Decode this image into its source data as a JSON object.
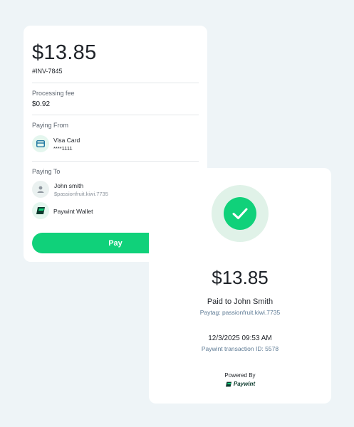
{
  "payment": {
    "amount": "$13.85",
    "invoice": "#INV-7845",
    "fee_label": "Processing fee",
    "fee_value": "$0.92",
    "paying_from_label": "Paying From",
    "card_name": "Visa Card",
    "card_number": "****1111",
    "paying_to_label": "Paying To",
    "payee_name": "John smith",
    "payee_tag": "$passionfruit.kiwi.7735",
    "wallet_name": "Paywint Wallet",
    "pay_button": "Pay"
  },
  "receipt": {
    "amount": "$13.85",
    "paid_to": "Paid to John Smith",
    "paytag": "Paytag: passionfruit.kiwi.7735",
    "datetime": "12/3/2025 09:53 AM",
    "transaction": "Paywint transaction ID: 5578",
    "powered_by": "Powered By",
    "brand": "Paywint"
  },
  "colors": {
    "accent": "#10d17a",
    "background": "#eef4f7"
  }
}
